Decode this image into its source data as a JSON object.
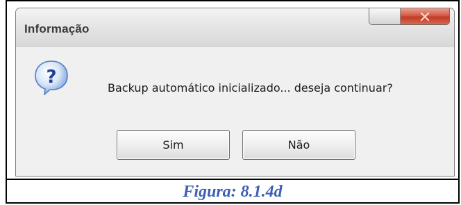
{
  "dialog": {
    "title": "Informação",
    "message": "Backup automático inicializado... deseja continuar?",
    "icon": "question-icon",
    "buttons": {
      "yes_label": "Sim",
      "no_label": "Não"
    }
  },
  "figure": {
    "caption": "Figura: 8.1.4d"
  },
  "colors": {
    "caption": "#3d5fb3",
    "close_button": "#c94a35",
    "dialog_body": "#f0f0f0"
  }
}
